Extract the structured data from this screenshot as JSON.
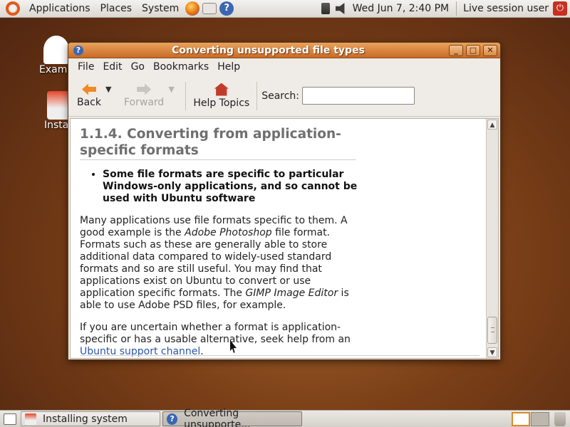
{
  "top_panel": {
    "menus": [
      "Applications",
      "Places",
      "System"
    ],
    "clock": "Wed Jun  7,  2:40 PM",
    "user": "Live session user"
  },
  "desktop": {
    "icons": [
      {
        "label": "Examples",
        "visible_label": "Exam"
      },
      {
        "label": "Install",
        "visible_label": "Inst"
      }
    ]
  },
  "window": {
    "title": "Converting unsupported file types",
    "menubar": [
      "File",
      "Edit",
      "Go",
      "Bookmarks",
      "Help"
    ],
    "toolbar": {
      "back": "Back",
      "forward": "Forward",
      "help_topics": "Help Topics",
      "search_label": "Search:",
      "search_value": ""
    },
    "content": {
      "heading": "1.1.4.  Converting from application-specific formats",
      "bullet": "Some file formats are specific to particular Windows-only applications, and so cannot be used with Ubuntu software",
      "para1": {
        "part1": "Many applications use file formats specific to them. A good example is the ",
        "em1": "Adobe Photoshop",
        "part2": " file format. Formats such as these are generally able to store additional data compared to widely-used standard formats and so are still useful. You may find that applications exist on Ubuntu to convert or use application specific formats. The ",
        "em2": "GIMP Image Editor",
        "part3": " is able to use Adobe PSD files, for example."
      },
      "para2": {
        "text": "If you are uncertain whether a format is application-specific or has a usable alternative, seek help from an ",
        "link": "Ubuntu support channel",
        "end": "."
      }
    },
    "scroll_position": 0.9
  },
  "taskbar": {
    "tasks": [
      {
        "label": "Installing system",
        "active": false
      },
      {
        "label": "Converting unsupporte...",
        "active": true
      }
    ]
  },
  "colors": {
    "accent": "#e05a1b",
    "titlebar": "#d98a45",
    "link": "#2a56a8"
  }
}
